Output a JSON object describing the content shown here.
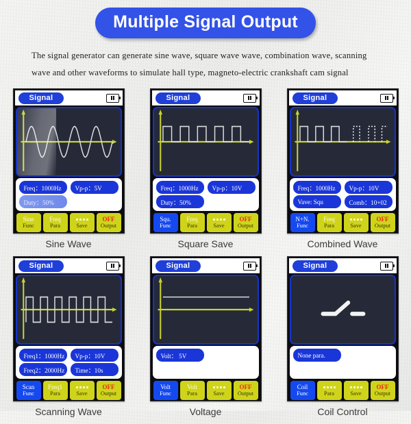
{
  "banner": {
    "title": "Multiple Signal Output"
  },
  "description": {
    "line1": "The signal generator can generate sine wave, square wave wave, combination wave, scanning",
    "line2": "wave and other waveforms to simulate hall type, magneto-electric crankshaft cam signal"
  },
  "colors": {
    "banner_blue": "#3352e8",
    "pill_blue": "#1a36d8",
    "key_yellow": "#cfd41a",
    "key_selected_blue": "#1549f0",
    "off_red": "#e82b1b",
    "screen_bg": "#262a38",
    "screen_border": "#1634c9",
    "axis_yellow": "#c8d432",
    "trace_white": "#dcdcdc"
  },
  "devices": [
    {
      "caption": "Sine Wave",
      "titlebar": {
        "signal_label": "Signal",
        "battery_icon": "battery-icon"
      },
      "waveform": "sine",
      "params": [
        {
          "text": "Freq：1000Hz",
          "style": "normal"
        },
        {
          "text": "Vp-p：5V",
          "style": "normal"
        },
        {
          "text": "Duty：50%",
          "style": "dim"
        },
        {
          "text": "",
          "style": "empty"
        }
      ],
      "keys": [
        {
          "top": "Sine",
          "bottom": "Func",
          "selected": false,
          "dots": false,
          "off": false
        },
        {
          "top": "Freq",
          "bottom": "Para",
          "selected": false,
          "dots": false,
          "off": false
        },
        {
          "top": "",
          "bottom": "Save",
          "selected": false,
          "dots": true,
          "off": false
        },
        {
          "top": "OFF",
          "bottom": "Output",
          "selected": false,
          "dots": false,
          "off": true
        }
      ]
    },
    {
      "caption": "Square Save",
      "titlebar": {
        "signal_label": "Signal",
        "battery_icon": "battery-icon"
      },
      "waveform": "square",
      "params": [
        {
          "text": "Freq：1000Hz",
          "style": "normal"
        },
        {
          "text": "Vp-p：10V",
          "style": "normal"
        },
        {
          "text": "Duty：50%",
          "style": "normal"
        },
        {
          "text": "",
          "style": "empty"
        }
      ],
      "keys": [
        {
          "top": "Squ.",
          "bottom": "Func",
          "selected": true,
          "dots": false,
          "off": false
        },
        {
          "top": "Freq",
          "bottom": "Para",
          "selected": false,
          "dots": false,
          "off": false
        },
        {
          "top": "",
          "bottom": "Save",
          "selected": false,
          "dots": true,
          "off": false
        },
        {
          "top": "OFF",
          "bottom": "Output",
          "selected": false,
          "dots": false,
          "off": true
        }
      ]
    },
    {
      "caption": "Combined Wave",
      "titlebar": {
        "signal_label": "Signal",
        "battery_icon": "battery-icon"
      },
      "waveform": "combined",
      "params": [
        {
          "text": "Freq：1000Hz",
          "style": "normal"
        },
        {
          "text": "Vp-p：10V",
          "style": "normal"
        },
        {
          "text": "Vave: Squ",
          "style": "normal"
        },
        {
          "text": "Comb：10+02",
          "style": "normal"
        }
      ],
      "keys": [
        {
          "top": "N+N.",
          "bottom": "Func",
          "selected": true,
          "dots": false,
          "off": false
        },
        {
          "top": "Freq",
          "bottom": "Para",
          "selected": false,
          "dots": false,
          "off": false
        },
        {
          "top": "",
          "bottom": "Save",
          "selected": false,
          "dots": true,
          "off": false
        },
        {
          "top": "OFF",
          "bottom": "Output",
          "selected": false,
          "dots": false,
          "off": true
        }
      ]
    },
    {
      "caption": "Scanning Wave",
      "titlebar": {
        "signal_label": "Signal",
        "battery_icon": "battery-icon"
      },
      "waveform": "scanning",
      "params": [
        {
          "text": "Freq1：1000Hz",
          "style": "normal"
        },
        {
          "text": "Vp-p：10V",
          "style": "normal"
        },
        {
          "text": "Freq2：2000Hz",
          "style": "normal"
        },
        {
          "text": "Time：10s",
          "style": "normal"
        }
      ],
      "keys": [
        {
          "top": "Scan",
          "bottom": "Func",
          "selected": true,
          "dots": false,
          "off": false
        },
        {
          "top": "Freq1",
          "bottom": "Para",
          "selected": false,
          "dots": false,
          "off": false
        },
        {
          "top": "",
          "bottom": "Save",
          "selected": false,
          "dots": true,
          "off": false
        },
        {
          "top": "OFF",
          "bottom": "Output",
          "selected": false,
          "dots": false,
          "off": true
        }
      ]
    },
    {
      "caption": "Voltage",
      "titlebar": {
        "signal_label": "Signal",
        "battery_icon": "battery-icon"
      },
      "waveform": "voltage",
      "params": [
        {
          "text": "Volt：  5V",
          "style": "normal"
        },
        {
          "text": "",
          "style": "empty"
        },
        {
          "text": "",
          "style": "empty"
        },
        {
          "text": "",
          "style": "empty"
        }
      ],
      "keys": [
        {
          "top": "Volt",
          "bottom": "Func",
          "selected": true,
          "dots": false,
          "off": false
        },
        {
          "top": "Volt",
          "bottom": "Para",
          "selected": false,
          "dots": false,
          "off": false
        },
        {
          "top": "",
          "bottom": "Save",
          "selected": false,
          "dots": true,
          "off": false
        },
        {
          "top": "OFF",
          "bottom": "Output",
          "selected": false,
          "dots": false,
          "off": true
        }
      ]
    },
    {
      "caption": "Coil Control",
      "titlebar": {
        "signal_label": "Signal",
        "battery_icon": "battery-icon"
      },
      "waveform": "coil",
      "params": [
        {
          "text": "None para.",
          "style": "normal"
        },
        {
          "text": "",
          "style": "empty"
        },
        {
          "text": "",
          "style": "empty"
        },
        {
          "text": "",
          "style": "empty"
        }
      ],
      "keys": [
        {
          "top": "Coil",
          "bottom": "Func",
          "selected": true,
          "dots": false,
          "off": false
        },
        {
          "top": "",
          "bottom": "Para",
          "selected": false,
          "dots": true,
          "off": false
        },
        {
          "top": "",
          "bottom": "Save",
          "selected": false,
          "dots": true,
          "off": false
        },
        {
          "top": "OFF",
          "bottom": "Output",
          "selected": false,
          "dots": false,
          "off": true
        }
      ]
    }
  ]
}
